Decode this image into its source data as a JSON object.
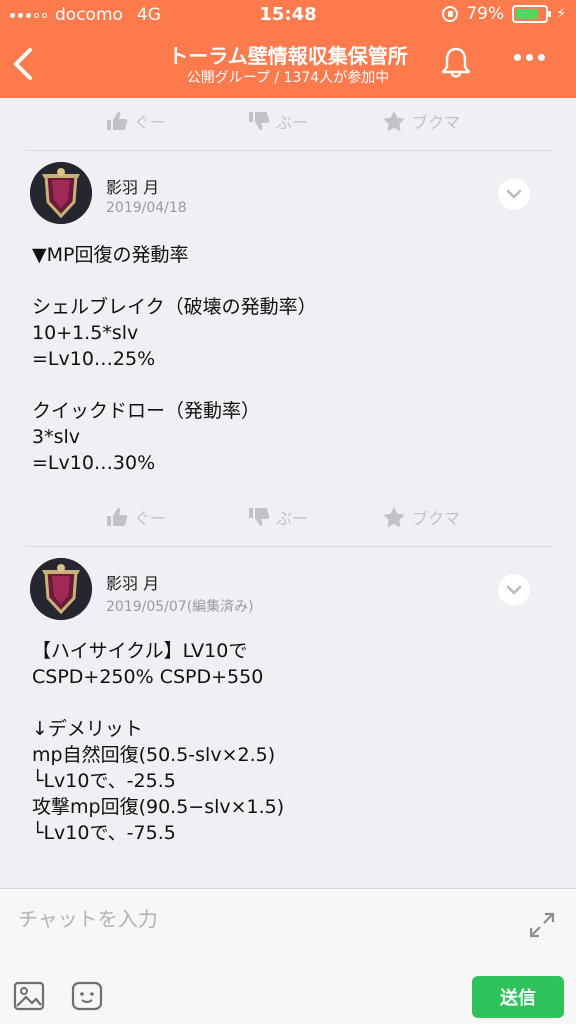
{
  "status_bar": {
    "carrier": "docomo",
    "network": "4G",
    "time": "15:48",
    "battery": "79%",
    "battery_level": 0.79
  },
  "header": {
    "title": "トーラム壁情報収集保管所",
    "subtitle": "公開グループ / 1374人が参加中",
    "color": "#ff7a4d"
  },
  "reaction_labels": {
    "good": "ぐー",
    "bad": "ぶー",
    "bookmark": "ブクマ"
  },
  "posts": [
    {
      "author": "影羽 月",
      "date": "2019/04/18",
      "body": "▼MP回復の発動率\n\nシェルブレイク（破壊の発動率）\n10+1.5*slv\n=Lv10…25%\n\nクイックドロー（発動率）\n3*slv\n=Lv10…30%"
    },
    {
      "author": "影羽 月",
      "date": "2019/05/07(編集済み)",
      "body": "【ハイサイクル】LV10で\nCSPD+250% CSPD+550\n\n↓デメリット\nmp自然回復(50.5-slv×2.5)\n└Lv10で、-25.5\n攻撃mp回復(90.5−slv×1.5)\n└Lv10で、-75.5"
    }
  ],
  "composer": {
    "placeholder": "チャットを入力",
    "send_label": "送信"
  }
}
